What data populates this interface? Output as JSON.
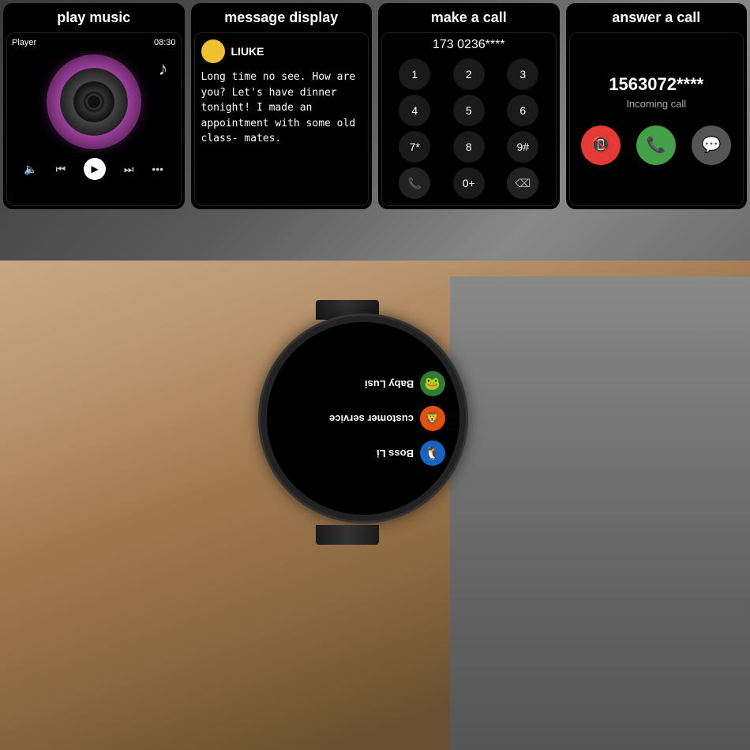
{
  "panels": {
    "music": {
      "header": "play music",
      "player_label": "Player",
      "time": "08:30",
      "music_note": "♪"
    },
    "message": {
      "header": "message display",
      "sender": "LIUKE",
      "body": "Long time no see. How are you? Let's have dinner tonight! I made an appointment with some old class-\nmates."
    },
    "dialer": {
      "header": "make a call",
      "number": "173 0236****",
      "keys": [
        "1",
        "2",
        "3",
        "4",
        "5",
        "6",
        "7*",
        "8",
        "9#",
        "☎",
        "0+",
        "⌫"
      ]
    },
    "answer": {
      "header": "answer a call",
      "number": "1563072****",
      "label": "Incoming call"
    }
  },
  "watch": {
    "contacts": [
      {
        "name": "Baby Lusi",
        "color": "#2e7d32",
        "icon": "🐸"
      },
      {
        "name": "customer service",
        "color": "#e65100",
        "icon": "🦁"
      },
      {
        "name": "Boss Li",
        "color": "#1565c0",
        "icon": "🐧"
      }
    ]
  }
}
